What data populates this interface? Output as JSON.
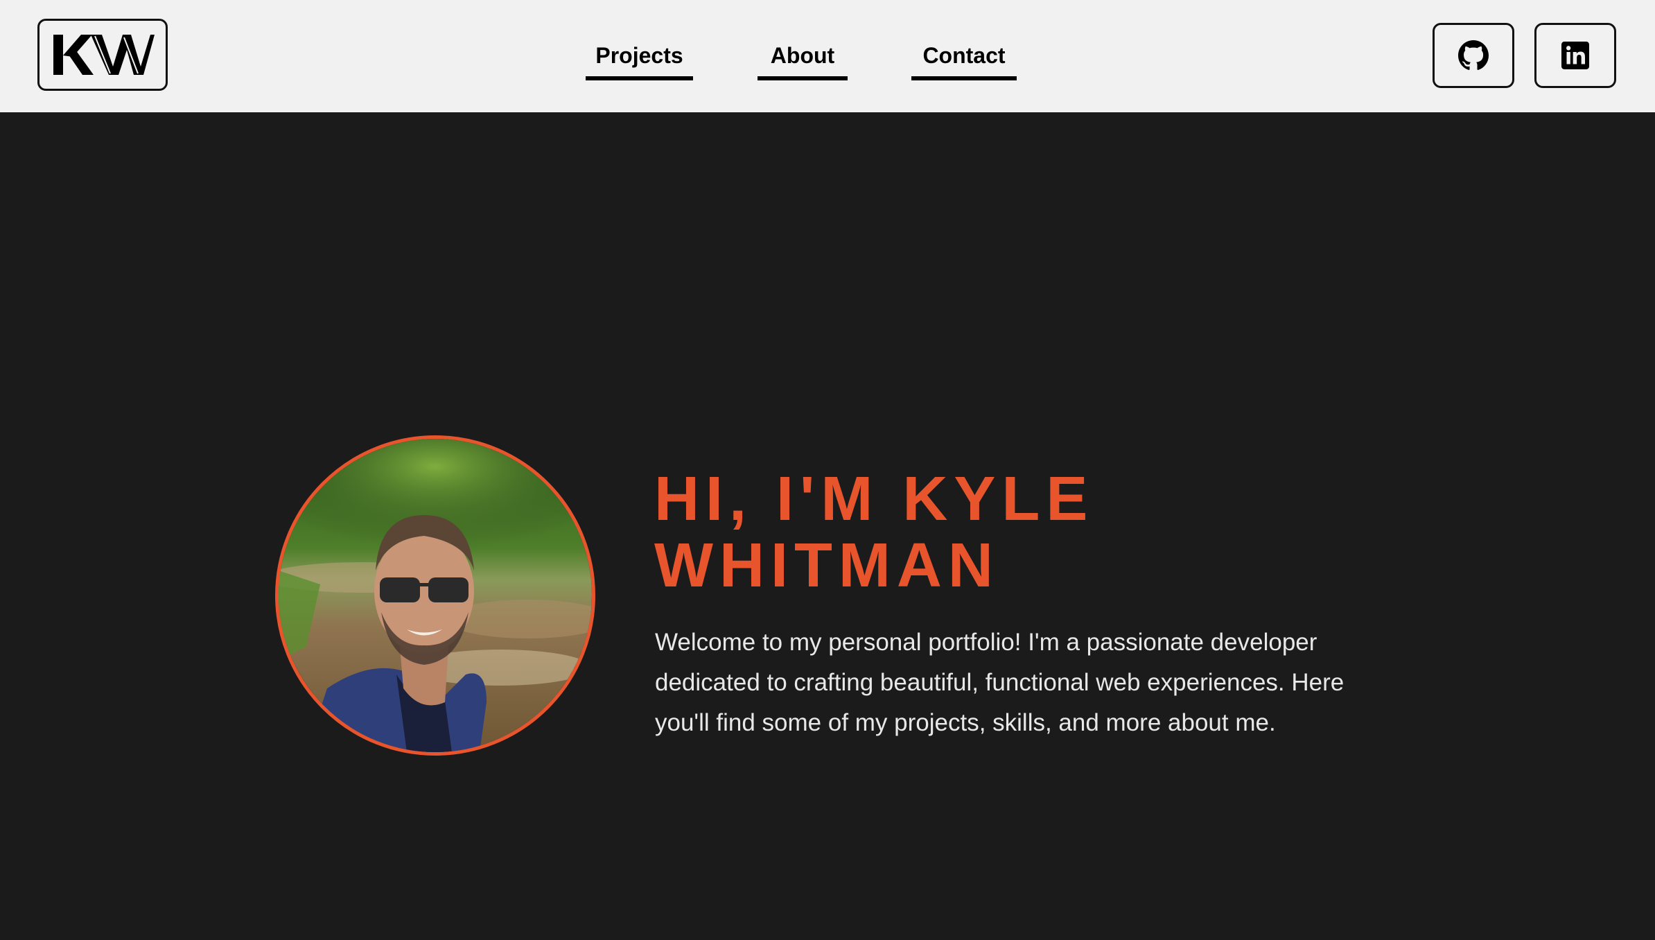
{
  "logo": {
    "text": "KW",
    "icon": "kw-monogram-logo"
  },
  "nav": {
    "items": [
      {
        "label": "Projects"
      },
      {
        "label": "About"
      },
      {
        "label": "Contact"
      }
    ]
  },
  "social": {
    "github_icon": "github-icon",
    "linkedin_icon": "linkedin-icon"
  },
  "hero": {
    "headline_line1": "HI, I'M KYLE",
    "headline_line2": "WHITMAN",
    "intro": "Welcome to my personal portfolio! I'm a passionate developer dedicated to crafting beautiful, functional web experiences. Here you'll find some of my projects, skills, and more about me.",
    "accent_color": "#e8552d",
    "background_color": "#1b1b1b"
  }
}
